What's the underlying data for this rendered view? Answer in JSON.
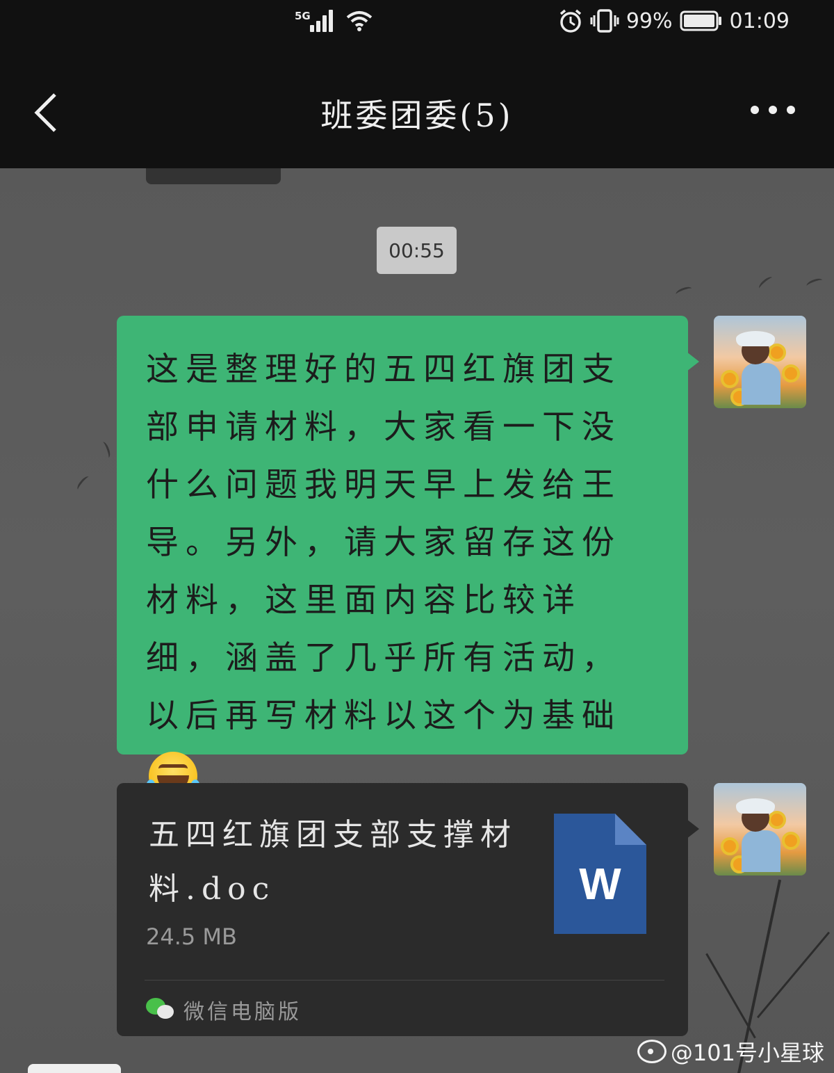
{
  "status_bar": {
    "network": "5G",
    "battery_percent": "99%",
    "time": "01:09"
  },
  "header": {
    "title": "班委团委(5)",
    "back_icon": "chevron-left-icon",
    "more_icon": "more-icon"
  },
  "chat": {
    "timestamp": "00:55",
    "messages": [
      {
        "type": "text",
        "text": "这是整理好的五四红旗团支部申请材料，大家看一下没什么问题我明天早上发给王导。另外，请大家留存这份材料，这里面内容比较详细，涵盖了几乎所有活动，以后再写材料以这个为基础",
        "emoji": "laughing-crying-emoji"
      },
      {
        "type": "file",
        "file_name": "五四红旗团支部支撑材料.doc",
        "file_size": "24.5  MB",
        "file_icon_letter": "W",
        "source": "微信电脑版"
      }
    ]
  },
  "watermark": {
    "text": "@101号小星球"
  },
  "colors": {
    "green_bubble": "#3eb575",
    "file_bubble": "#2b2b2b",
    "word_blue": "#2b579a"
  }
}
